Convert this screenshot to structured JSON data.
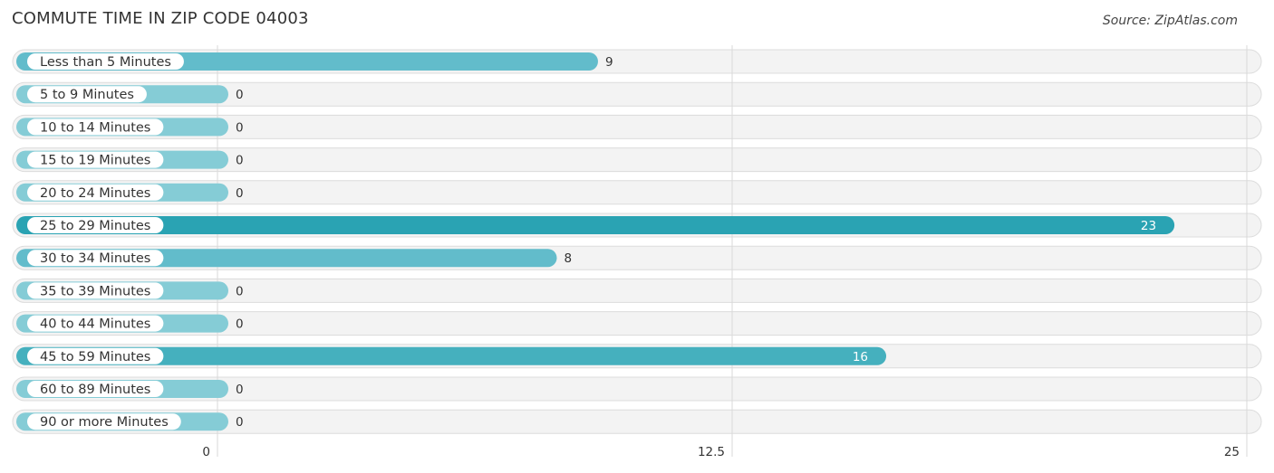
{
  "header": {
    "title": "COMMUTE TIME IN ZIP CODE 04003",
    "source": "Source: ZipAtlas.com"
  },
  "chart_data": {
    "type": "bar",
    "orientation": "horizontal",
    "title": "COMMUTE TIME IN ZIP CODE 04003",
    "xlabel": "",
    "ylabel": "",
    "categories": [
      "Less than 5 Minutes",
      "5 to 9 Minutes",
      "10 to 14 Minutes",
      "15 to 19 Minutes",
      "20 to 24 Minutes",
      "25 to 29 Minutes",
      "30 to 34 Minutes",
      "35 to 39 Minutes",
      "40 to 44 Minutes",
      "45 to 59 Minutes",
      "60 to 89 Minutes",
      "90 or more Minutes"
    ],
    "values": [
      9,
      0,
      0,
      0,
      0,
      23,
      8,
      0,
      0,
      16,
      0,
      0
    ],
    "xlim": [
      0,
      25
    ],
    "ticks": [
      {
        "value": 0,
        "label": "0"
      },
      {
        "value": 12.5,
        "label": "12.5"
      },
      {
        "value": 25,
        "label": "25"
      }
    ],
    "grid": true,
    "colors": {
      "highest": "#2aa3b3",
      "high": "#45b0be",
      "normal": "#62bccb",
      "zero": "#85ccd6",
      "track": "#f3f3f3"
    }
  }
}
